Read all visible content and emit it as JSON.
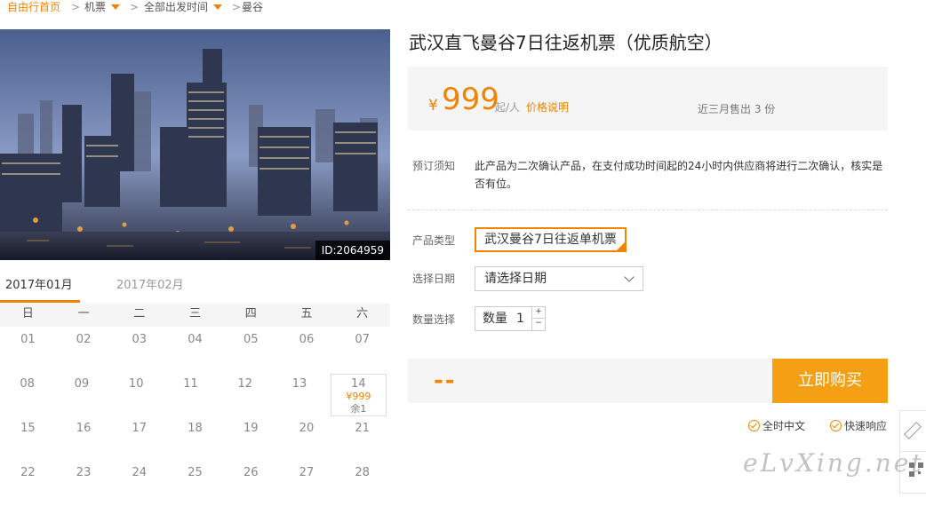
{
  "breadcrumb": {
    "home": "自由行首页",
    "items": [
      "机票",
      "全部出发时间",
      "曼谷"
    ],
    "separator": ">"
  },
  "hero": {
    "image_id": "ID:2064959"
  },
  "calendar": {
    "tabs": [
      "2017年01月",
      "2017年02月"
    ],
    "weekdays": [
      "日",
      "一",
      "二",
      "三",
      "四",
      "五",
      "六"
    ],
    "weeks": [
      [
        "01",
        "02",
        "03",
        "04",
        "05",
        "06",
        "07"
      ],
      [
        "08",
        "09",
        "10",
        "11",
        "12",
        "13",
        "14"
      ],
      [
        "15",
        "16",
        "17",
        "18",
        "19",
        "20",
        "21"
      ],
      [
        "22",
        "23",
        "24",
        "25",
        "26",
        "27",
        "28"
      ]
    ],
    "available": {
      "day": "14",
      "price": "¥999",
      "stock": "余1"
    }
  },
  "product": {
    "title": "武汉直飞曼谷7日往返机票（优质航空）",
    "price_symbol": "¥",
    "price": "999",
    "price_unit": "起/人",
    "price_link": "价格说明",
    "sold": "近三月售出 3 份",
    "notice_label": "预订须知",
    "notice_text": "此产品为二次确认产品，在支付成功时间起的24小时内供应商将进行二次确认，核实是否有位。",
    "type_label": "产品类型",
    "type_value": "武汉曼谷7日往返单机票",
    "date_label": "选择日期",
    "date_placeholder": "请选择日期",
    "qty_label": "数量选择",
    "qty_text": "数量",
    "qty_value": "1",
    "qty_plus": "+",
    "qty_minus": "−",
    "total": "--",
    "buy_label": "立即购买",
    "badges": [
      "全时中文",
      "快速响应"
    ]
  },
  "watermark": "eLvXing.net",
  "colors": {
    "accent": "#f08300",
    "buy_button": "#f5a014",
    "panel_bg": "#f5f5f5"
  }
}
